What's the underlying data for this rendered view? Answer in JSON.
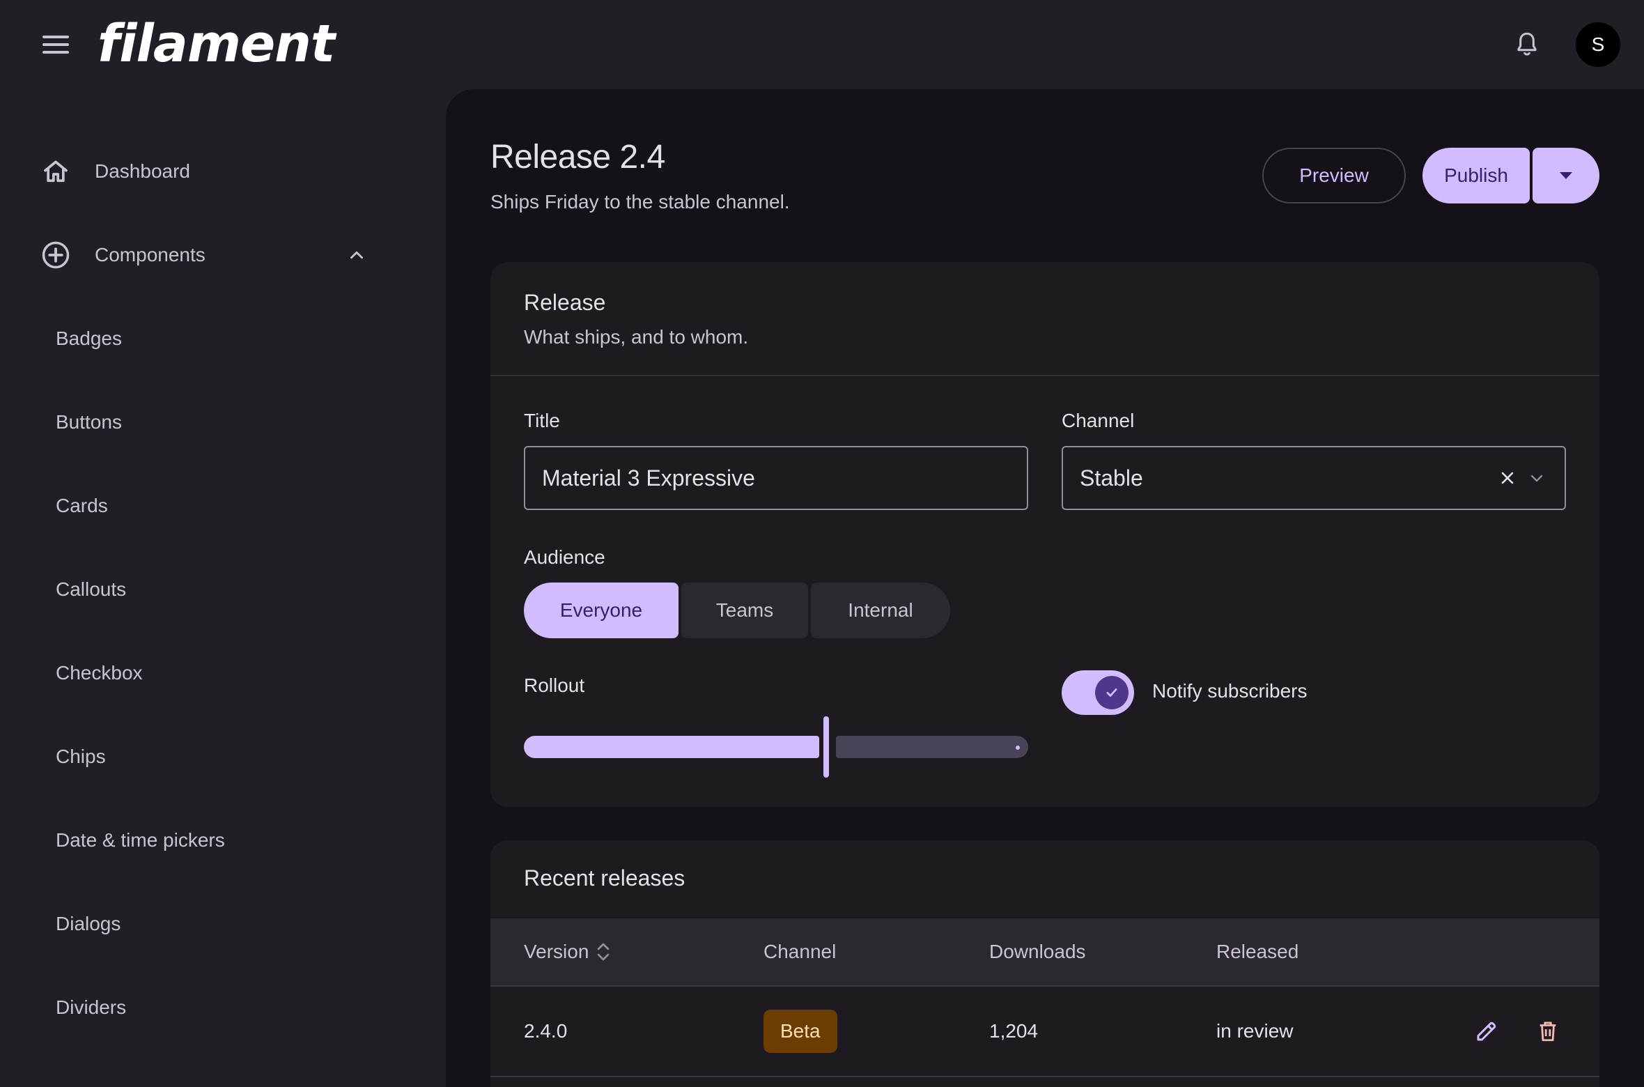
{
  "topbar": {
    "logo_text": "filament",
    "avatar_initial": "S"
  },
  "sidebar": {
    "items": [
      {
        "label": "Dashboard",
        "icon": "home-icon"
      },
      {
        "label": "Components",
        "icon": "add-circle-icon",
        "expanded": true
      }
    ],
    "sub_items": [
      "Badges",
      "Buttons",
      "Cards",
      "Callouts",
      "Checkbox",
      "Chips",
      "Date & time pickers",
      "Dialogs",
      "Dividers"
    ]
  },
  "header": {
    "title": "Release 2.4",
    "subtitle": "Ships Friday to the stable channel.",
    "preview_label": "Preview",
    "publish_label": "Publish"
  },
  "release_card": {
    "title": "Release",
    "subtitle": "What ships, and to whom.",
    "title_field": {
      "label": "Title",
      "value": "Material 3 Expressive"
    },
    "channel_field": {
      "label": "Channel",
      "value": "Stable"
    },
    "audience": {
      "label": "Audience",
      "options": [
        "Everyone",
        "Teams",
        "Internal"
      ],
      "selected": "Everyone"
    },
    "rollout": {
      "label": "Rollout",
      "value_fraction": 0.6
    },
    "notify": {
      "label": "Notify subscribers",
      "checked": true
    }
  },
  "recent_card": {
    "title": "Recent releases",
    "columns": [
      "Version",
      "Channel",
      "Downloads",
      "Released"
    ],
    "rows": [
      {
        "version": "2.4.0",
        "channel": "Beta",
        "downloads": "1,204",
        "released": "in review"
      }
    ]
  },
  "colors": {
    "primary": "#d0bcff",
    "on_primary": "#381e72",
    "surface": "#141218",
    "surface_container": "#1d1b20",
    "badge_beta_bg": "#6b3d00",
    "badge_beta_text": "#ffddb3",
    "error": "#f2b8b5"
  }
}
